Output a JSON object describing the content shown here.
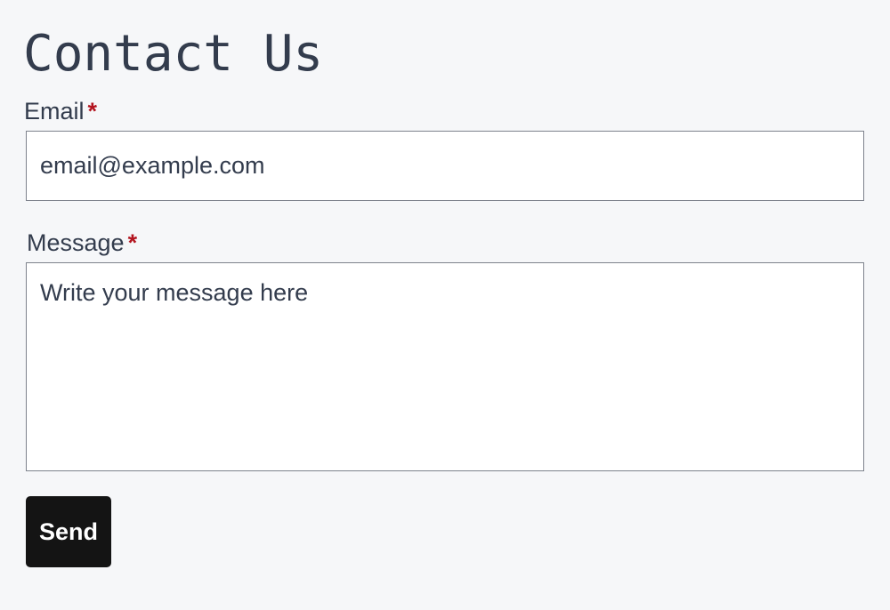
{
  "page": {
    "title": "Contact Us"
  },
  "form": {
    "email": {
      "label": "Email",
      "required_marker": "*",
      "value": "",
      "placeholder": "email@example.com"
    },
    "message": {
      "label": "Message",
      "required_marker": "*",
      "value": "",
      "placeholder": "Write your message here"
    },
    "submit_label": "Send"
  },
  "colors": {
    "background": "#f6f7f9",
    "text": "#333c4d",
    "required": "#b3141f",
    "button_bg": "#141414",
    "button_text": "#ffffff",
    "field_border": "#7d828c"
  }
}
